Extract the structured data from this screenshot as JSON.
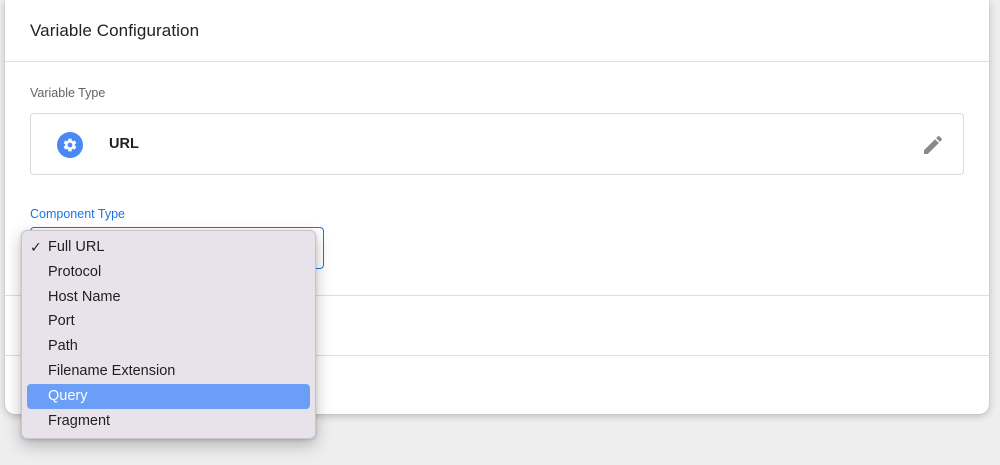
{
  "card": {
    "title": "Variable Configuration"
  },
  "variable_type": {
    "label": "Variable Type",
    "name": "URL",
    "icon": "gear-icon",
    "edit_icon": "pencil-icon",
    "icon_color": "#4a89f3"
  },
  "component_type": {
    "label": "Component Type",
    "selected": "Full URL",
    "highlighted": "Query",
    "check_mark": "✓",
    "options": [
      "Full URL",
      "Protocol",
      "Host Name",
      "Port",
      "Path",
      "Filename Extension",
      "Query",
      "Fragment"
    ]
  },
  "colors": {
    "accent": "#1a73e8",
    "highlight": "#6a9ef7",
    "menu_bg": "#e8e3ea"
  }
}
